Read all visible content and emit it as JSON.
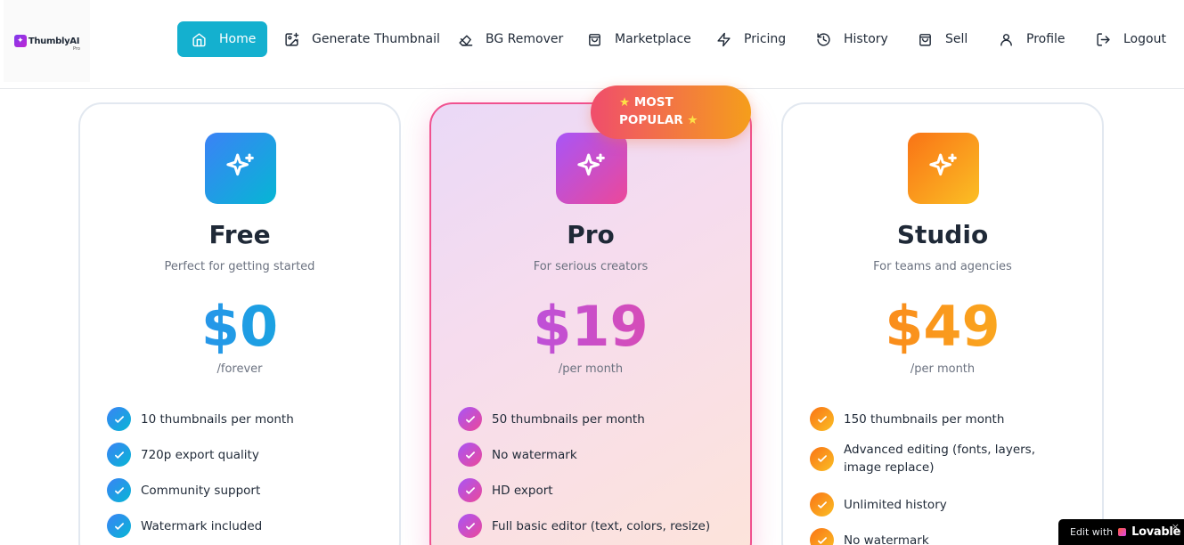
{
  "brand": {
    "name": "ThumblyAI",
    "sub": "Pro"
  },
  "nav": [
    {
      "label": "Home",
      "icon": "home-icon",
      "active": true
    },
    {
      "label": "Generate Thumbnail",
      "icon": "image-plus-icon"
    },
    {
      "label": "BG Remover",
      "icon": "eraser-icon"
    },
    {
      "label": "Marketplace",
      "icon": "shopping-bag-icon"
    },
    {
      "label": "Pricing",
      "icon": "zap-icon"
    },
    {
      "label": "History",
      "icon": "history-icon"
    },
    {
      "label": "Sell",
      "icon": "shopping-bag-icon"
    },
    {
      "label": "Profile",
      "icon": "user-icon"
    },
    {
      "label": "Logout",
      "icon": "logout-icon"
    }
  ],
  "badge": {
    "line1": "MOST",
    "line2": "POPULAR",
    "icon": "star-icon"
  },
  "plans": [
    {
      "name": "Free",
      "description": "Perfect for getting started",
      "price": "$0",
      "period": "/forever",
      "icon": "sparkles-icon",
      "colors": {
        "from": "#3b82f6",
        "to": "#06b6d4"
      },
      "features": [
        "10 thumbnails per month",
        "720p export quality",
        "Community support",
        "Watermark included"
      ]
    },
    {
      "name": "Pro",
      "description": "For serious creators",
      "price": "$19",
      "period": "/per month",
      "icon": "sparkles-icon",
      "highlighted": true,
      "colors": {
        "from": "#a855f7",
        "to": "#ec4899"
      },
      "features": [
        "50 thumbnails per month",
        "No watermark",
        "HD export",
        "Full basic editor (text, colors, resize)"
      ]
    },
    {
      "name": "Studio",
      "description": "For teams and agencies",
      "price": "$49",
      "period": "/per month",
      "icon": "sparkles-icon",
      "colors": {
        "from": "#f97316",
        "to": "#fbbf24"
      },
      "features": [
        "150 thumbnails per month",
        "Advanced editing (fonts, layers, image replace)",
        "Unlimited history",
        "No watermark"
      ]
    }
  ],
  "lovable": {
    "edit": "Edit with",
    "brand": "Lovable",
    "close": "×"
  }
}
